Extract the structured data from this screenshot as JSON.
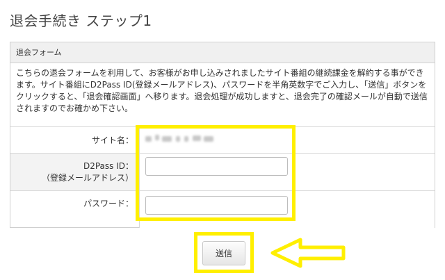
{
  "page": {
    "title": "退会手続き ステップ1"
  },
  "form": {
    "header": "退会フォーム",
    "description": "こちらの退会フォームを利用して、お客様がお申し込みされましたサイト番組の継続課金を解約する事ができます。サイト番組にD2Pass ID(登録メールアドレス)、パスワードを半角英数字でご入力し、「送信」ボタンをクリックすると、「退会確認画面」へ移ります。退会処理が成功しますと、退会完了の確認メールが自動で送信されますのでお確かめ下さい。",
    "site_name_label": "サイト名：",
    "d2pass_label": "D2Pass ID：",
    "d2pass_sublabel": "（登録メールアドレス）",
    "password_label": "パスワード：",
    "d2pass_value": "",
    "password_value": "",
    "submit_label": "送信"
  },
  "colors": {
    "highlight": "#ffef00",
    "header_bg": "#f0f0f0",
    "border": "#cfcfcf"
  }
}
